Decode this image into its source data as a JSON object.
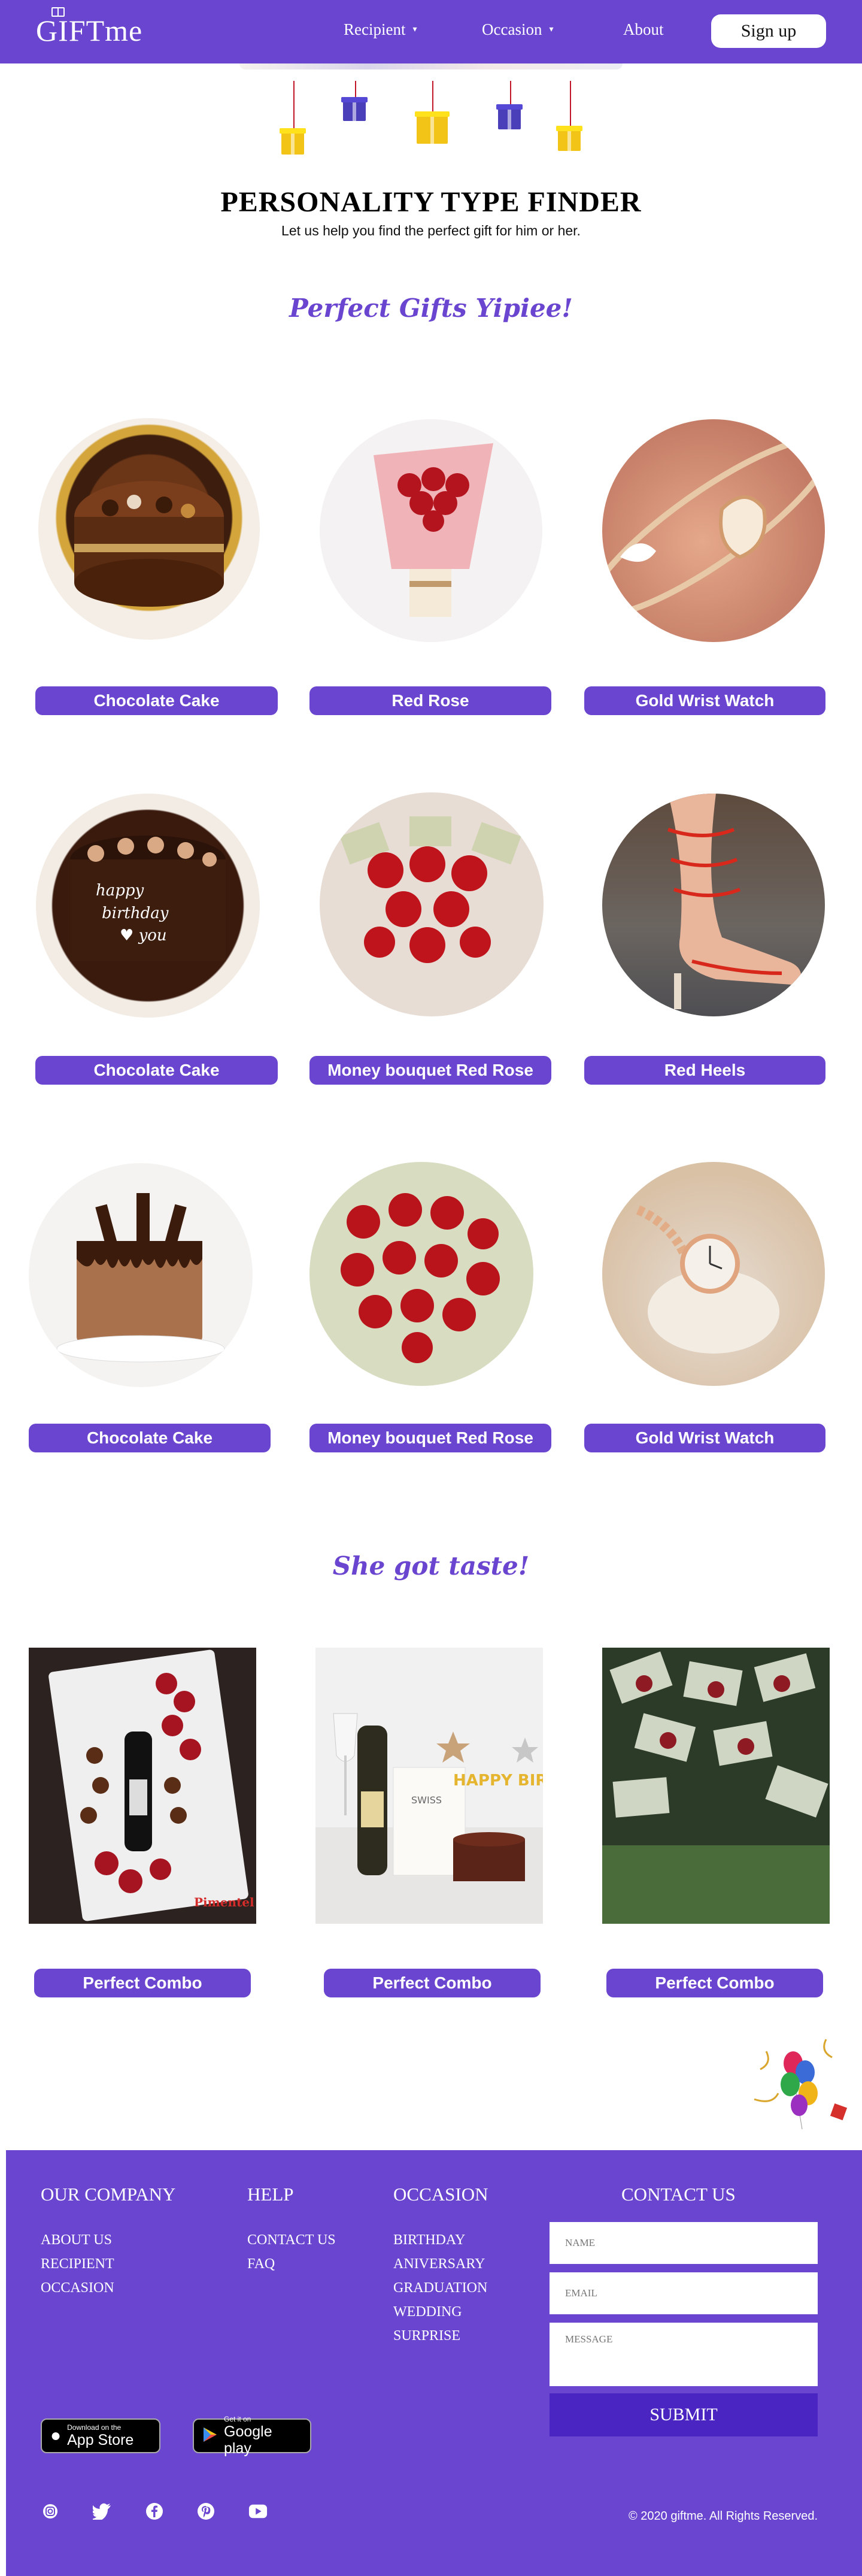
{
  "nav": {
    "logo": "GIFTme",
    "items": [
      {
        "label": "Recipient",
        "caret": "▾"
      },
      {
        "label": "Occasion",
        "caret": "▾"
      },
      {
        "label": "About"
      }
    ],
    "signup_label": "Sign up"
  },
  "hero": {
    "title": "PERSONALITY TYPE FINDER",
    "subtitle": "Let us help you find the perfect gift for him or her."
  },
  "section1": {
    "heading": "Perfect Gifts Yipiee!",
    "products": [
      {
        "label": "Chocolate Cake"
      },
      {
        "label": "Red Rose"
      },
      {
        "label": "Gold Wrist Watch"
      },
      {
        "label": "Chocolate Cake"
      },
      {
        "label": "Money bouquet Red Rose"
      },
      {
        "label": "Red Heels"
      },
      {
        "label": "Chocolate Cake"
      },
      {
        "label": "Money bouquet Red Rose"
      },
      {
        "label": "Gold Wrist Watch"
      }
    ]
  },
  "section2": {
    "heading": "She got taste!",
    "combos": [
      {
        "label": "Perfect Combo"
      },
      {
        "label": "Perfect Combo"
      },
      {
        "label": "Perfect Combo"
      }
    ],
    "photo_texts": {
      "pimentel": "Pimentel",
      "birthday_topper": "HAPPY BIRTHDAY",
      "box_brand": "SWISS"
    }
  },
  "footer": {
    "company": {
      "title": "OUR COMPANY",
      "links": [
        "ABOUT US",
        "RECIPIENT",
        "OCCASION"
      ]
    },
    "help": {
      "title": "HELP",
      "links": [
        "CONTACT US",
        "FAQ"
      ]
    },
    "occasion": {
      "title": "OCCASION",
      "links": [
        "BIRTHDAY",
        "ANIVERSARY",
        "GRADUATION",
        "WEDDING",
        "SURPRISE"
      ]
    },
    "contact": {
      "title": "CONTACT US",
      "name_placeholder": "NAME",
      "email_placeholder": "EMAIL",
      "message_placeholder": "MESSAGE",
      "submit_label": "SUBMIT"
    },
    "app_store": {
      "small": "Download on the",
      "big": "App Store"
    },
    "google_play": {
      "small": "Get it on",
      "big": "Google play"
    },
    "social_icons": [
      "instagram-icon",
      "twitter-icon",
      "facebook-icon",
      "pinterest-icon",
      "youtube-icon"
    ],
    "copyright": "© 2020 giftme.  All Rights Reserved."
  },
  "colors": {
    "brand": "#6a45cf",
    "submit": "#4b25c2",
    "white": "#ffffff"
  }
}
